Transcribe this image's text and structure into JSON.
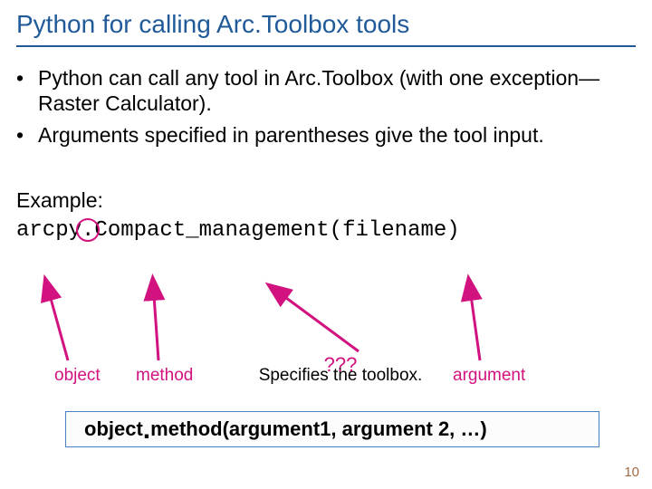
{
  "title": "Python for calling Arc.Toolbox tools",
  "bullets": [
    "Python can call any tool in Arc.Toolbox (with one exception—Raster Calculator).",
    "Arguments specified in parentheses give the tool input."
  ],
  "example_label": "Example:",
  "code_parts": {
    "p1": "arcpy",
    "dot": ".",
    "p2": "Compact_management(filename)"
  },
  "labels": {
    "object": "object",
    "method": "method",
    "specifies": "Specifies the toolbox.",
    "questions": "???",
    "argument": "argument"
  },
  "footer": {
    "pre": "object",
    "dot": ".",
    "post": "method(argument1, argument 2, …)"
  },
  "page_number": "10",
  "colors": {
    "brand": "#215a99",
    "accent": "#d1127f"
  }
}
